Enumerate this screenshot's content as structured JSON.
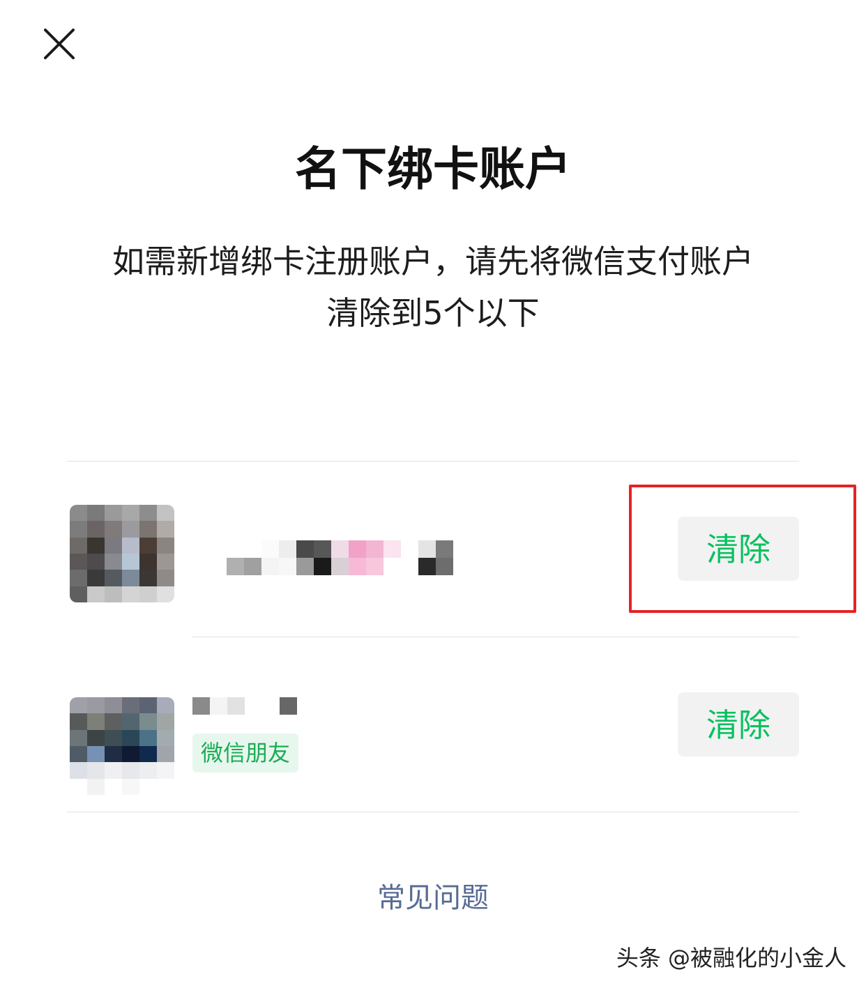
{
  "header": {
    "close_icon": "close-icon"
  },
  "main": {
    "title": "名下绑卡账户",
    "description_line1": "如需新增绑卡注册账户，请先将微信支付账户",
    "description_line2": "清除到5个以下"
  },
  "accounts": [
    {
      "clear_label": "清除",
      "highlighted": true,
      "highlight_color": "#e62224"
    },
    {
      "tag": "微信朋友",
      "clear_label": "清除"
    }
  ],
  "footer": {
    "faq_link": "常见问题"
  },
  "watermark": "头条 @被融化的小金人",
  "colors": {
    "accent_green": "#07c160",
    "link_blue": "#576b95",
    "button_bg": "#f2f2f2"
  }
}
